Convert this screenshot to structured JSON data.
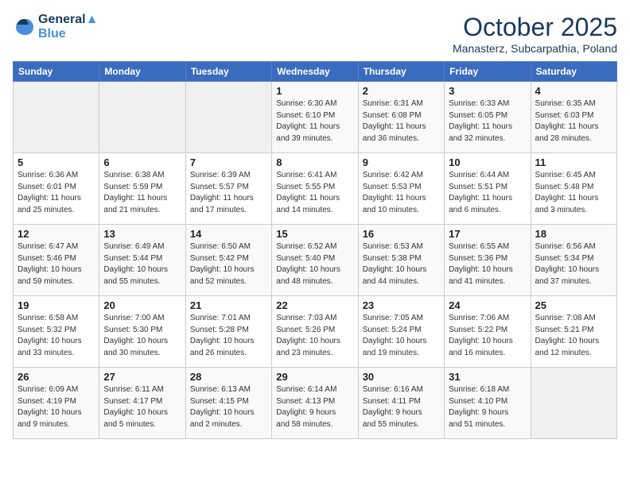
{
  "header": {
    "logo_line1": "General",
    "logo_line2": "Blue",
    "month": "October 2025",
    "location": "Manasterz, Subcarpathia, Poland"
  },
  "days_of_week": [
    "Sunday",
    "Monday",
    "Tuesday",
    "Wednesday",
    "Thursday",
    "Friday",
    "Saturday"
  ],
  "weeks": [
    [
      {
        "day": "",
        "info": ""
      },
      {
        "day": "",
        "info": ""
      },
      {
        "day": "",
        "info": ""
      },
      {
        "day": "1",
        "info": "Sunrise: 6:30 AM\nSunset: 6:10 PM\nDaylight: 11 hours\nand 39 minutes."
      },
      {
        "day": "2",
        "info": "Sunrise: 6:31 AM\nSunset: 6:08 PM\nDaylight: 11 hours\nand 36 minutes."
      },
      {
        "day": "3",
        "info": "Sunrise: 6:33 AM\nSunset: 6:05 PM\nDaylight: 11 hours\nand 32 minutes."
      },
      {
        "day": "4",
        "info": "Sunrise: 6:35 AM\nSunset: 6:03 PM\nDaylight: 11 hours\nand 28 minutes."
      }
    ],
    [
      {
        "day": "5",
        "info": "Sunrise: 6:36 AM\nSunset: 6:01 PM\nDaylight: 11 hours\nand 25 minutes."
      },
      {
        "day": "6",
        "info": "Sunrise: 6:38 AM\nSunset: 5:59 PM\nDaylight: 11 hours\nand 21 minutes."
      },
      {
        "day": "7",
        "info": "Sunrise: 6:39 AM\nSunset: 5:57 PM\nDaylight: 11 hours\nand 17 minutes."
      },
      {
        "day": "8",
        "info": "Sunrise: 6:41 AM\nSunset: 5:55 PM\nDaylight: 11 hours\nand 14 minutes."
      },
      {
        "day": "9",
        "info": "Sunrise: 6:42 AM\nSunset: 5:53 PM\nDaylight: 11 hours\nand 10 minutes."
      },
      {
        "day": "10",
        "info": "Sunrise: 6:44 AM\nSunset: 5:51 PM\nDaylight: 11 hours\nand 6 minutes."
      },
      {
        "day": "11",
        "info": "Sunrise: 6:45 AM\nSunset: 5:48 PM\nDaylight: 11 hours\nand 3 minutes."
      }
    ],
    [
      {
        "day": "12",
        "info": "Sunrise: 6:47 AM\nSunset: 5:46 PM\nDaylight: 10 hours\nand 59 minutes."
      },
      {
        "day": "13",
        "info": "Sunrise: 6:49 AM\nSunset: 5:44 PM\nDaylight: 10 hours\nand 55 minutes."
      },
      {
        "day": "14",
        "info": "Sunrise: 6:50 AM\nSunset: 5:42 PM\nDaylight: 10 hours\nand 52 minutes."
      },
      {
        "day": "15",
        "info": "Sunrise: 6:52 AM\nSunset: 5:40 PM\nDaylight: 10 hours\nand 48 minutes."
      },
      {
        "day": "16",
        "info": "Sunrise: 6:53 AM\nSunset: 5:38 PM\nDaylight: 10 hours\nand 44 minutes."
      },
      {
        "day": "17",
        "info": "Sunrise: 6:55 AM\nSunset: 5:36 PM\nDaylight: 10 hours\nand 41 minutes."
      },
      {
        "day": "18",
        "info": "Sunrise: 6:56 AM\nSunset: 5:34 PM\nDaylight: 10 hours\nand 37 minutes."
      }
    ],
    [
      {
        "day": "19",
        "info": "Sunrise: 6:58 AM\nSunset: 5:32 PM\nDaylight: 10 hours\nand 33 minutes."
      },
      {
        "day": "20",
        "info": "Sunrise: 7:00 AM\nSunset: 5:30 PM\nDaylight: 10 hours\nand 30 minutes."
      },
      {
        "day": "21",
        "info": "Sunrise: 7:01 AM\nSunset: 5:28 PM\nDaylight: 10 hours\nand 26 minutes."
      },
      {
        "day": "22",
        "info": "Sunrise: 7:03 AM\nSunset: 5:26 PM\nDaylight: 10 hours\nand 23 minutes."
      },
      {
        "day": "23",
        "info": "Sunrise: 7:05 AM\nSunset: 5:24 PM\nDaylight: 10 hours\nand 19 minutes."
      },
      {
        "day": "24",
        "info": "Sunrise: 7:06 AM\nSunset: 5:22 PM\nDaylight: 10 hours\nand 16 minutes."
      },
      {
        "day": "25",
        "info": "Sunrise: 7:08 AM\nSunset: 5:21 PM\nDaylight: 10 hours\nand 12 minutes."
      }
    ],
    [
      {
        "day": "26",
        "info": "Sunrise: 6:09 AM\nSunset: 4:19 PM\nDaylight: 10 hours\nand 9 minutes."
      },
      {
        "day": "27",
        "info": "Sunrise: 6:11 AM\nSunset: 4:17 PM\nDaylight: 10 hours\nand 5 minutes."
      },
      {
        "day": "28",
        "info": "Sunrise: 6:13 AM\nSunset: 4:15 PM\nDaylight: 10 hours\nand 2 minutes."
      },
      {
        "day": "29",
        "info": "Sunrise: 6:14 AM\nSunset: 4:13 PM\nDaylight: 9 hours\nand 58 minutes."
      },
      {
        "day": "30",
        "info": "Sunrise: 6:16 AM\nSunset: 4:11 PM\nDaylight: 9 hours\nand 55 minutes."
      },
      {
        "day": "31",
        "info": "Sunrise: 6:18 AM\nSunset: 4:10 PM\nDaylight: 9 hours\nand 51 minutes."
      },
      {
        "day": "",
        "info": ""
      }
    ]
  ]
}
